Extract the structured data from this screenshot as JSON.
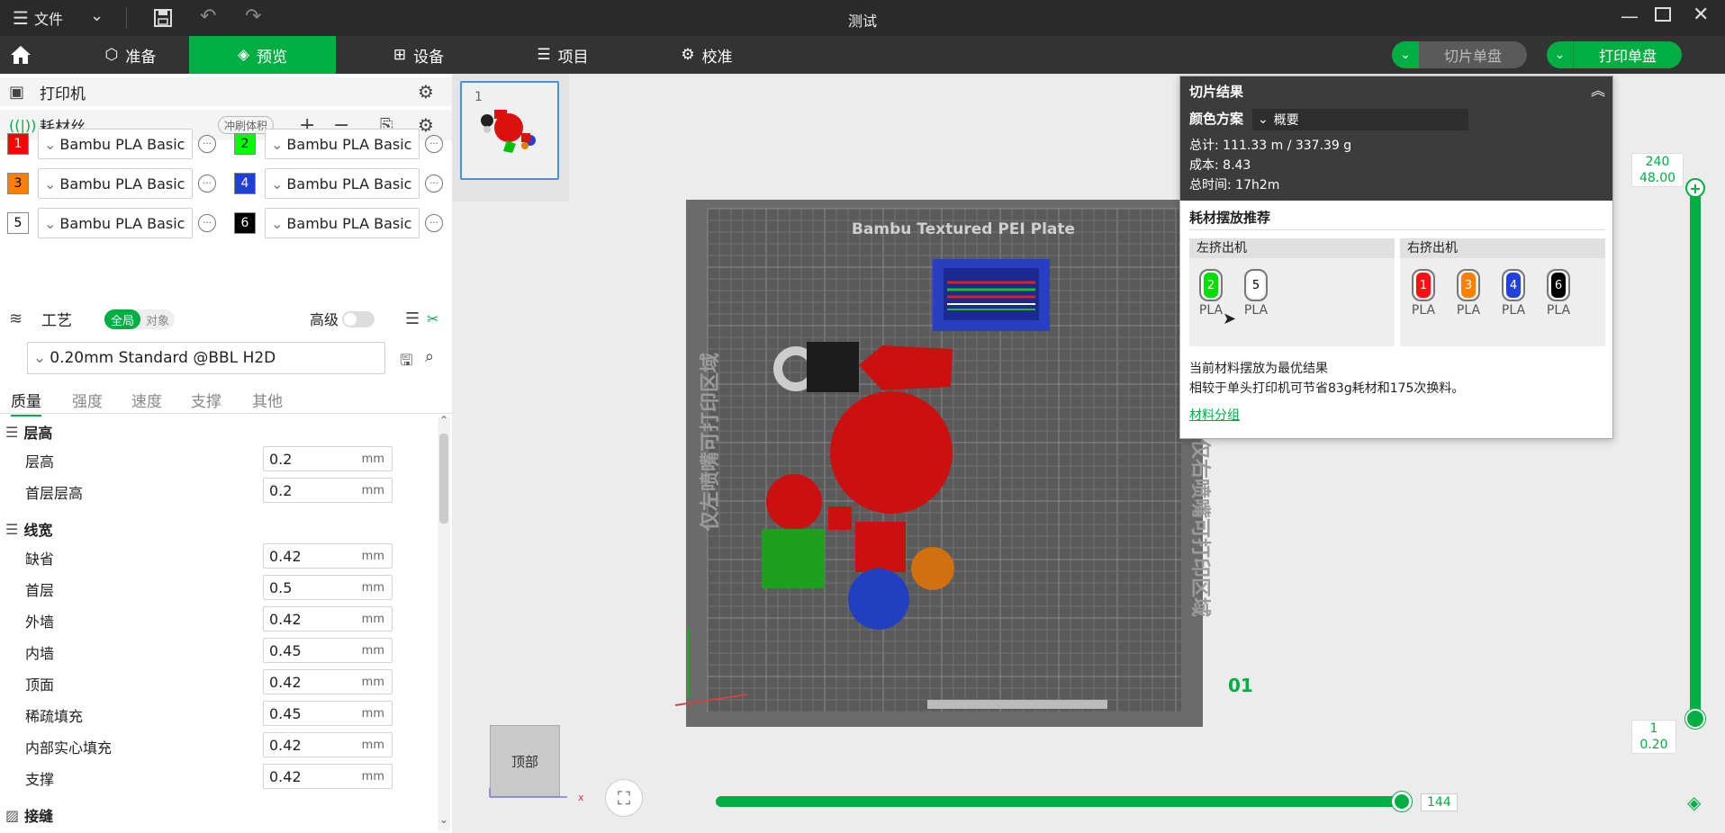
{
  "titlebar": {
    "menu_label": "文件",
    "title": "测试"
  },
  "tabs": [
    {
      "label": "准备"
    },
    {
      "label": "预览"
    },
    {
      "label": "设备"
    },
    {
      "label": "项目"
    },
    {
      "label": "校准"
    }
  ],
  "actions": {
    "slice_label": "切片单盘",
    "print_label": "打印单盘"
  },
  "printer": {
    "label": "打印机"
  },
  "filament": {
    "label": "耗材丝",
    "flush_label": "冲刷体积",
    "slots": [
      {
        "num": "1",
        "color": "#ff0000",
        "name": "Bambu PLA Basic"
      },
      {
        "num": "2",
        "color": "#00ff00",
        "name": "Bambu PLA Basic"
      },
      {
        "num": "3",
        "color": "#ff8000",
        "name": "Bambu PLA Basic"
      },
      {
        "num": "4",
        "color": "#1f3fd8",
        "name": "Bambu PLA Basic"
      },
      {
        "num": "5",
        "color": "#ffffff",
        "name": "Bambu PLA Basic"
      },
      {
        "num": "6",
        "color": "#000000",
        "name": "Bambu PLA Basic"
      }
    ]
  },
  "process": {
    "label": "工艺",
    "toggle_global": "全局",
    "toggle_object": "对象",
    "advanced_label": "高级",
    "preset": "0.20mm Standard @BBL H2D",
    "subtabs": [
      "质量",
      "强度",
      "速度",
      "支撑",
      "其他"
    ]
  },
  "groups": {
    "layer_height": {
      "title": "层高",
      "params": [
        {
          "label": "层高",
          "value": "0.2",
          "unit": "mm"
        },
        {
          "label": "首层层高",
          "value": "0.2",
          "unit": "mm"
        }
      ]
    },
    "line_width": {
      "title": "线宽",
      "params": [
        {
          "label": "缺省",
          "value": "0.42",
          "unit": "mm"
        },
        {
          "label": "首层",
          "value": "0.5",
          "unit": "mm"
        },
        {
          "label": "外墙",
          "value": "0.42",
          "unit": "mm"
        },
        {
          "label": "内墙",
          "value": "0.45",
          "unit": "mm"
        },
        {
          "label": "顶面",
          "value": "0.42",
          "unit": "mm"
        },
        {
          "label": "稀疏填充",
          "value": "0.45",
          "unit": "mm"
        },
        {
          "label": "内部实心填充",
          "value": "0.42",
          "unit": "mm"
        },
        {
          "label": "支撑",
          "value": "0.42",
          "unit": "mm"
        }
      ]
    },
    "seam": {
      "title": "接缝"
    }
  },
  "thumbnail": {
    "index": "1"
  },
  "plate": {
    "name": "Bambu Textured PEI Plate",
    "left_text": "仅左喷嘴可打印区域",
    "right_text": "仅右喷嘴可打印区域",
    "plate_number": "01"
  },
  "view_cube": {
    "label": "顶部"
  },
  "slice_result": {
    "title": "切片结果",
    "color_scheme_label": "颜色方案",
    "color_scheme_value": "概要",
    "total": "总计:  111.33 m / 337.39 g",
    "cost": "成本:  8.43",
    "time": "总时间:  17h2m"
  },
  "recommend": {
    "title": "耗材摆放推荐",
    "left_extruder": "左挤出机",
    "right_extruder": "右挤出机",
    "left_spools": [
      {
        "num": "2",
        "color": "#00dd00",
        "type": "PLA"
      },
      {
        "num": "5",
        "color": "#ffffff",
        "type": "PLA"
      }
    ],
    "right_spools": [
      {
        "num": "1",
        "color": "#ff1010",
        "type": "PLA"
      },
      {
        "num": "3",
        "color": "#ff8000",
        "type": "PLA"
      },
      {
        "num": "4",
        "color": "#2040e0",
        "type": "PLA"
      },
      {
        "num": "6",
        "color": "#000000",
        "type": "PLA"
      }
    ],
    "note1": "当前材料摆放为最优结果",
    "note2": "相较于单头打印机可节省83g耗材和175次换料。",
    "link": "材料分组"
  },
  "layer_slider": {
    "top_layer": "240",
    "top_height": "48.00",
    "bottom_layer": "1",
    "bottom_height": "0.20"
  },
  "move_slider": {
    "value": "144"
  },
  "colors": {
    "accent": "#00ae42"
  }
}
